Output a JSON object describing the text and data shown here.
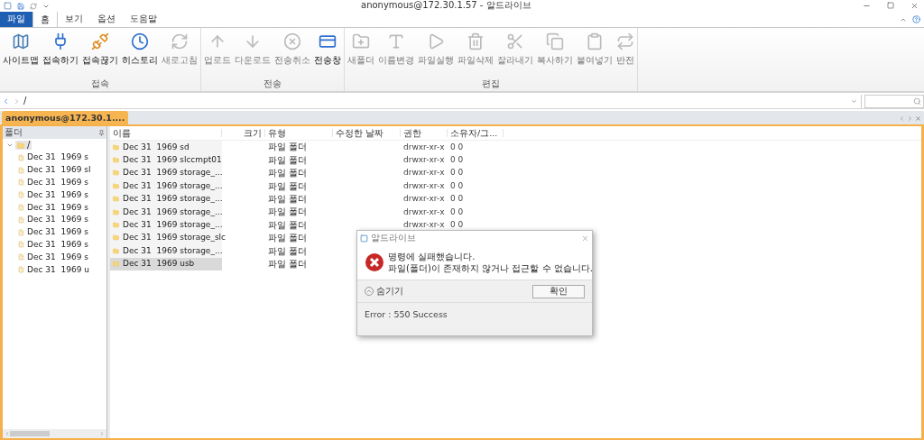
{
  "window": {
    "title": "anonymous@172.30.1.57 - 알드라이브"
  },
  "menu_tabs": [
    {
      "label": "파일",
      "kind": "file",
      "selected": false
    },
    {
      "label": "홈",
      "kind": "tab",
      "selected": true
    },
    {
      "label": "보기",
      "kind": "tab",
      "selected": false
    },
    {
      "label": "옵션",
      "kind": "tab",
      "selected": false
    },
    {
      "label": "도움말",
      "kind": "tab",
      "selected": false
    }
  ],
  "ribbon_groups": [
    {
      "label": "접속",
      "buttons": [
        {
          "label": "사이트맵",
          "disabled": false
        },
        {
          "label": "접속하기",
          "disabled": false
        },
        {
          "label": "접속끊기",
          "disabled": false
        },
        {
          "label": "히스토리",
          "disabled": false
        },
        {
          "label": "새로고침",
          "disabled": true
        }
      ]
    },
    {
      "label": "전송",
      "buttons": [
        {
          "label": "업로드",
          "disabled": true
        },
        {
          "label": "다운로드",
          "disabled": true
        },
        {
          "label": "전송취소",
          "disabled": true
        },
        {
          "label": "전송창",
          "disabled": false
        }
      ]
    },
    {
      "label": "편집",
      "buttons": [
        {
          "label": "새폴더",
          "disabled": true
        },
        {
          "label": "이름변경",
          "disabled": true
        },
        {
          "label": "파일실행",
          "disabled": true
        },
        {
          "label": "파일삭제",
          "disabled": true
        },
        {
          "label": "잘라내기",
          "disabled": true
        },
        {
          "label": "복사하기",
          "disabled": true
        },
        {
          "label": "붙여넣기",
          "disabled": true
        },
        {
          "label": "반전",
          "disabled": true
        }
      ]
    }
  ],
  "address": {
    "value": "/"
  },
  "session_tab": {
    "label": "anonymous@172.30.1....",
    "selected": true
  },
  "folder_pane": {
    "title": "폴더",
    "root": {
      "label": "/",
      "expanded": true,
      "selected": true,
      "children": [
        {
          "label": "Dec 31  1969 s",
          "selected": false
        },
        {
          "label": "Dec 31  1969 sl",
          "selected": false
        },
        {
          "label": "Dec 31  1969 s",
          "selected": false
        },
        {
          "label": "Dec 31  1969 s",
          "selected": false
        },
        {
          "label": "Dec 31  1969 s",
          "selected": false
        },
        {
          "label": "Dec 31  1969 s",
          "selected": false
        },
        {
          "label": "Dec 31  1969 s",
          "selected": false
        },
        {
          "label": "Dec 31  1969 s",
          "selected": false
        },
        {
          "label": "Dec 31  1969 s",
          "selected": false
        },
        {
          "label": "Dec 31  1969 u",
          "selected": false
        }
      ]
    }
  },
  "table": {
    "columns": [
      "이름",
      "크기",
      "유형",
      "수정한 날짜",
      "권한",
      "소유자/그..."
    ],
    "rows": [
      {
        "name": "Dec 31  1969 sd",
        "type": "파일 폴더",
        "permissions": "drwxr-xr-x",
        "owner": "0 0",
        "selected": false
      },
      {
        "name": "Dec 31  1969 slccmpt01",
        "type": "파일 폴더",
        "permissions": "drwxr-xr-x",
        "owner": "0 0",
        "selected": false
      },
      {
        "name": "Dec 31  1969 storage_...",
        "type": "파일 폴더",
        "permissions": "drwxr-xr-x",
        "owner": "0 0",
        "selected": false
      },
      {
        "name": "Dec 31  1969 storage_...",
        "type": "파일 폴더",
        "permissions": "drwxr-xr-x",
        "owner": "0 0",
        "selected": false
      },
      {
        "name": "Dec 31  1969 storage_...",
        "type": "파일 폴더",
        "permissions": "drwxr-xr-x",
        "owner": "0 0",
        "selected": false
      },
      {
        "name": "Dec 31  1969 storage_...",
        "type": "파일 폴더",
        "permissions": "drwxr-xr-x",
        "owner": "0 0",
        "selected": false
      },
      {
        "name": "Dec 31  1969 storage_...",
        "type": "파일 폴더",
        "permissions": "drwxr-xr-x",
        "owner": "0 0",
        "selected": false
      },
      {
        "name": "Dec 31  1969 storage_slc",
        "type": "파일 폴더",
        "selected": false
      },
      {
        "name": "Dec 31  1969 storage_...",
        "type": "파일 폴더",
        "selected": false
      },
      {
        "name": "Dec 31  1969 usb",
        "type": "파일 폴더",
        "selected": true
      }
    ]
  },
  "dialog": {
    "title": "알드라이브",
    "message_line1": "명령에 실패했습니다.",
    "message_line2": "파일(폴더)이 존재하지 않거나 접근할 수 없습니다.",
    "toggle": "숨기기",
    "ok": "확인",
    "detail": "Error : 550 Success"
  }
}
